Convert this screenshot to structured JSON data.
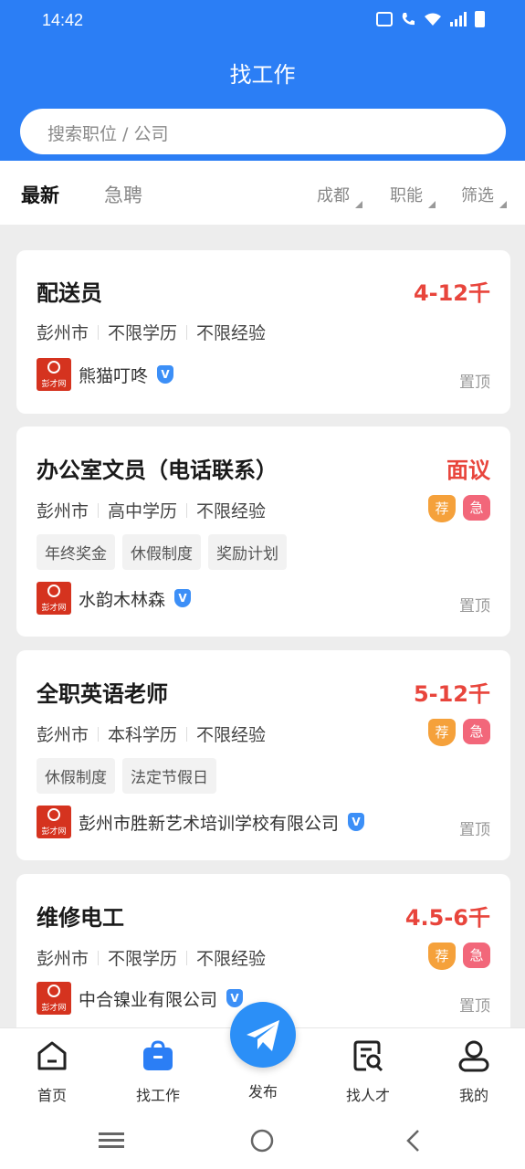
{
  "status": {
    "time": "14:42"
  },
  "header": {
    "title": "找工作",
    "search_placeholder": "搜索职位 / 公司"
  },
  "tabs": {
    "latest": "最新",
    "urgent": "急聘"
  },
  "filters": {
    "city": "成都",
    "function": "职能",
    "filter": "筛选"
  },
  "jobs": [
    {
      "title": "配送员",
      "salary": "4-12千",
      "location": "彭州市",
      "education": "不限学历",
      "experience": "不限经验",
      "tags": [],
      "company": "熊猫叮咚",
      "pin": "置顶",
      "badge_recommend": "",
      "badge_urgent": ""
    },
    {
      "title": "办公室文员（电话联系）",
      "salary": "面议",
      "location": "彭州市",
      "education": "高中学历",
      "experience": "不限经验",
      "tags": [
        "年终奖金",
        "休假制度",
        "奖励计划"
      ],
      "company": "水韵木林森",
      "pin": "置顶",
      "badge_recommend": "荐",
      "badge_urgent": "急"
    },
    {
      "title": "全职英语老师",
      "salary": "5-12千",
      "location": "彭州市",
      "education": "本科学历",
      "experience": "不限经验",
      "tags": [
        "休假制度",
        "法定节假日"
      ],
      "company": "彭州市胜新艺术培训学校有限公司",
      "pin": "置顶",
      "badge_recommend": "荐",
      "badge_urgent": "急"
    },
    {
      "title": "维修电工",
      "salary": "4.5-6千",
      "location": "彭州市",
      "education": "不限学历",
      "experience": "不限经验",
      "tags": [],
      "company": "中合镍业有限公司",
      "pin": "置顶",
      "badge_recommend": "荐",
      "badge_urgent": "急"
    }
  ],
  "logo_text": "彭才网",
  "verify_mark": "V",
  "bottom_nav": {
    "home": "首页",
    "jobs": "找工作",
    "publish": "发布",
    "talent": "找人才",
    "mine": "我的"
  },
  "colors": {
    "primary": "#2b7ef5",
    "salary": "#e8453c",
    "badge_recommend": "#f5a13b",
    "badge_urgent": "#f2677a"
  }
}
